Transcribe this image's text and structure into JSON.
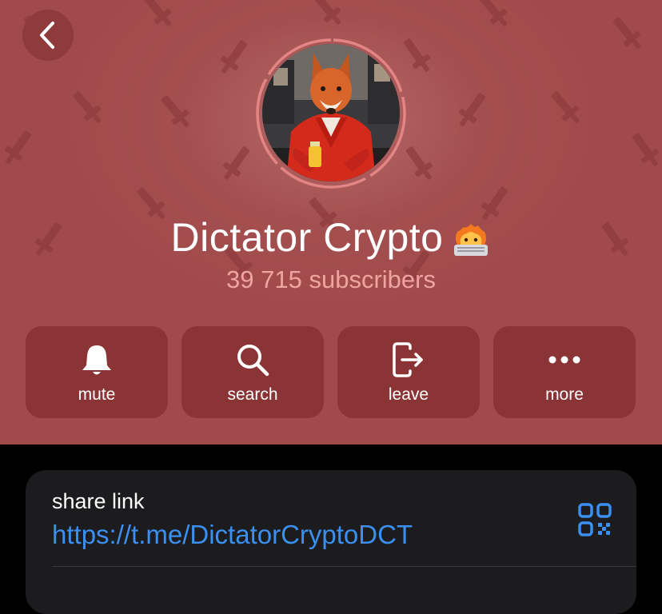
{
  "colors": {
    "header_bg": "#a44f4f",
    "button_bg": "#8b3435",
    "subscribers_text": "#f0a4a1",
    "link": "#3a8ff0",
    "card_bg": "#1c1c1e",
    "page_bg": "#000000"
  },
  "header": {
    "back_icon": "chevron-left-icon",
    "avatar_alt": "fox-in-red-suit-avatar",
    "pattern_icon": "sword-icon"
  },
  "channel": {
    "name": "Dictator Crypto",
    "emoji_icon": "fire-mascot-laptop-emoji",
    "subscribers": "39 715 subscribers"
  },
  "actions": [
    {
      "label": "mute",
      "icon": "bell-icon"
    },
    {
      "label": "search",
      "icon": "search-icon"
    },
    {
      "label": "leave",
      "icon": "leave-icon"
    },
    {
      "label": "more",
      "icon": "more-icon"
    }
  ],
  "share": {
    "title": "share link",
    "url": "https://t.me/DictatorCryptoDCT",
    "qr_icon": "qr-code-icon"
  }
}
